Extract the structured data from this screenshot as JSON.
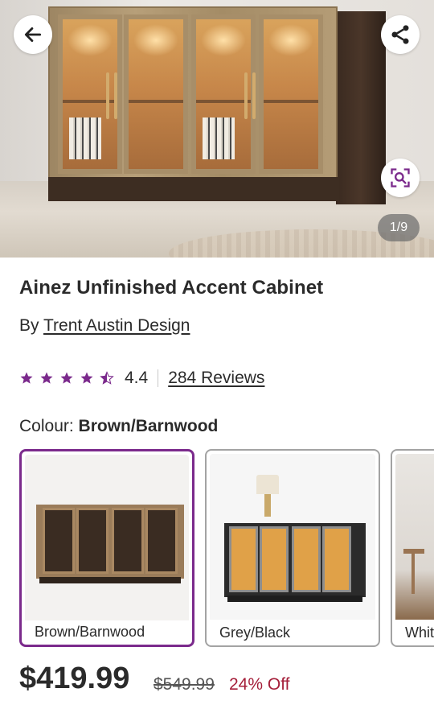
{
  "gallery": {
    "counter": "1/9",
    "back_icon": "arrow-left-icon",
    "share_icon": "share-icon",
    "zoom_icon": "visual-search-icon"
  },
  "product": {
    "title": "Ainez Unfinished Accent Cabinet",
    "by_prefix": "By",
    "brand": "Trent Austin Design",
    "rating": "4.4",
    "rating_value": 4.4,
    "stars_total": 5,
    "reviews": "284 Reviews"
  },
  "colour": {
    "label": "Colour:",
    "selected": "Brown/Barnwood",
    "options": [
      {
        "label": "Brown/Barnwood",
        "selected": true
      },
      {
        "label": "Grey/Black",
        "selected": false
      },
      {
        "label": "White",
        "selected": false
      }
    ]
  },
  "price": {
    "current": "$419.99",
    "original": "$549.99",
    "discount": "24% Off"
  },
  "colors": {
    "accent_purple": "#7b2a8c",
    "star_purple": "#7b2a8c",
    "discount_red": "#a51f3a",
    "text": "#2b2b2b"
  }
}
